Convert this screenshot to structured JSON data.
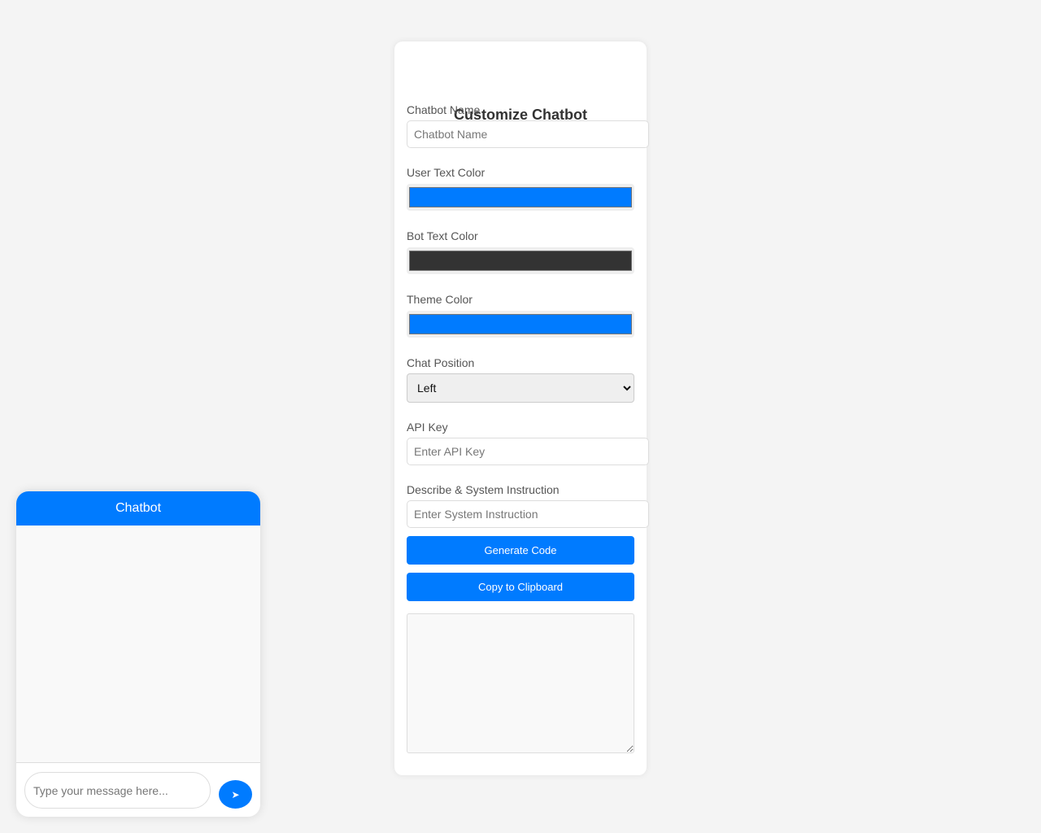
{
  "form": {
    "title": "Customize Chatbot",
    "chatbot_name": {
      "label": "Chatbot Name",
      "placeholder": "Chatbot Name",
      "value": ""
    },
    "user_text_color": {
      "label": "User Text Color",
      "value": "#007bff"
    },
    "bot_text_color": {
      "label": "Bot Text Color",
      "value": "#333333"
    },
    "theme_color": {
      "label": "Theme Color",
      "value": "#007bff"
    },
    "chat_position": {
      "label": "Chat Position",
      "selected": "Left"
    },
    "api_key": {
      "label": "API Key",
      "placeholder": "Enter API Key"
    },
    "system_instruction": {
      "label": "Describe & System Instruction",
      "placeholder": "Enter System Instruction"
    },
    "generate_label": "Generate Code",
    "copy_label": "Copy to Clipboard",
    "output_code": ""
  },
  "chat": {
    "title": "Chatbot",
    "input_placeholder": "Type your message here...",
    "send_icon": "send-arrow-icon",
    "send_glyph": "➤"
  }
}
